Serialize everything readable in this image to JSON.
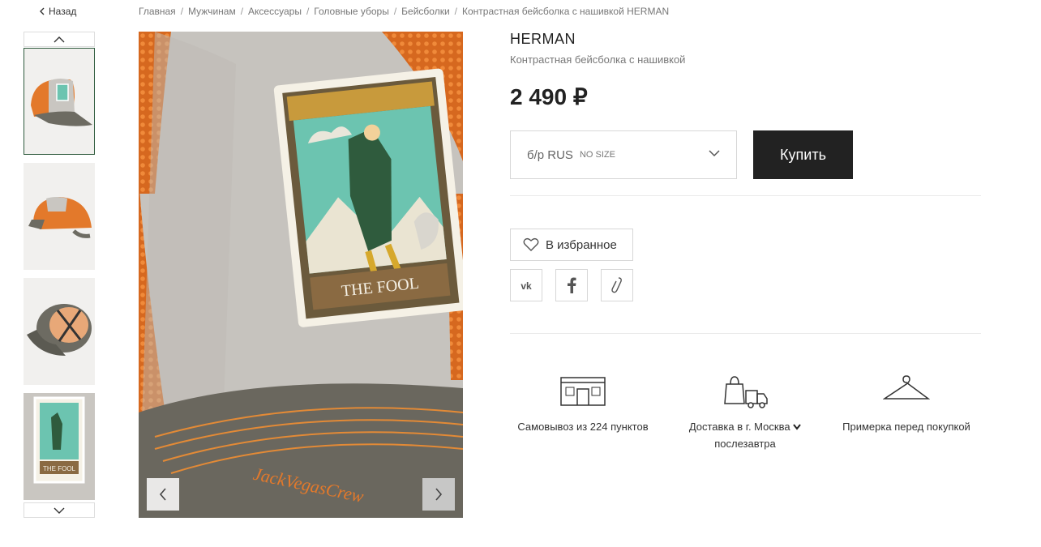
{
  "nav": {
    "back_label": "Назад",
    "breadcrumbs": [
      "Главная",
      "Мужчинам",
      "Аксессуары",
      "Головные уборы",
      "Бейсболки",
      "Контрастная бейсболка с нашивкой HERMAN"
    ]
  },
  "gallery": {
    "thumbs": [
      "cap-side-view",
      "cap-back-view",
      "cap-inside-view",
      "patch-closeup-view"
    ],
    "main_patch_text": "THE FOOL",
    "main_embroidery_text": "JackVegasCrew"
  },
  "product": {
    "brand": "HERMAN",
    "name": "Контрастная бейсболка с нашивкой",
    "price": "2 490 ₽",
    "size_value": "б/р RUS",
    "size_note": "NO SIZE",
    "buy_label": "Купить",
    "favorite_label": "В избранное",
    "share_icons": [
      "vk-icon",
      "facebook-icon",
      "link-icon"
    ]
  },
  "features": {
    "pickup": "Самовывоз из 224 пунктов",
    "delivery_prefix": "Доставка в",
    "delivery_city": "г. Москва",
    "delivery_when": "послезавтра",
    "fitting": "Примерка перед покупкой"
  },
  "colors": {
    "button_dark": "#222222",
    "active_thumb_border": "#2f5b3d",
    "mesh_orange": "#e3792b",
    "cap_grey": "#c9c6c1",
    "patch_teal": "#6cc4b0"
  }
}
